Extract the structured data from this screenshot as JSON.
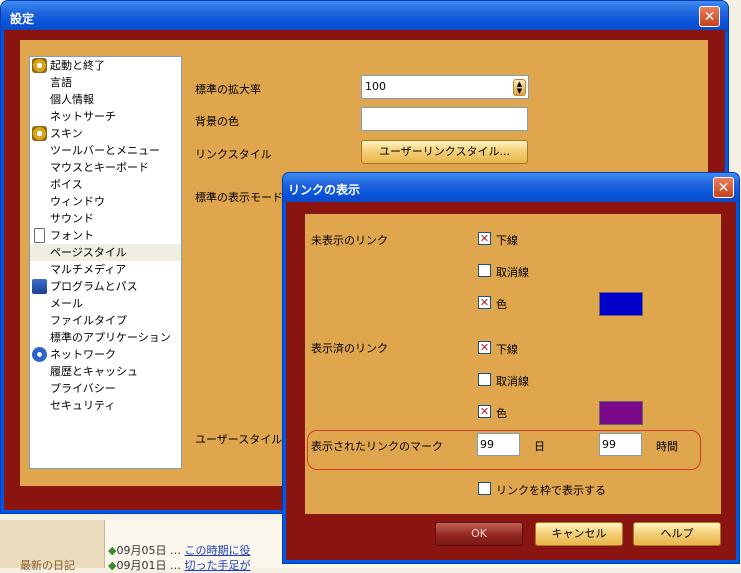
{
  "main_window": {
    "title": "設定",
    "close_glyph": "✕"
  },
  "tree": {
    "items": [
      {
        "label": "起動と終了",
        "level": 0,
        "icon": "gear-icon"
      },
      {
        "label": "言語",
        "level": 1
      },
      {
        "label": "個人情報",
        "level": 1
      },
      {
        "label": "ネットサーチ",
        "level": 1
      },
      {
        "label": "スキン",
        "level": 0,
        "icon": "gear-icon"
      },
      {
        "label": "ツールバーとメニュー",
        "level": 1
      },
      {
        "label": "マウスとキーボード",
        "level": 1
      },
      {
        "label": "ボイス",
        "level": 1
      },
      {
        "label": "ウィンドウ",
        "level": 1
      },
      {
        "label": "サウンド",
        "level": 1
      },
      {
        "label": "フォント",
        "level": 0,
        "icon": "page-icon"
      },
      {
        "label": "ページスタイル",
        "level": 1,
        "selected": true
      },
      {
        "label": "マルチメディア",
        "level": 1
      },
      {
        "label": "プログラムとパス",
        "level": 0,
        "icon": "disk-icon"
      },
      {
        "label": "メール",
        "level": 1
      },
      {
        "label": "ファイルタイプ",
        "level": 1
      },
      {
        "label": "標準のアプリケーション",
        "level": 1
      },
      {
        "label": "ネットワーク",
        "level": 0,
        "icon": "network-icon"
      },
      {
        "label": "履歴とキャッシュ",
        "level": 1
      },
      {
        "label": "プライバシー",
        "level": 1
      },
      {
        "label": "セキュリティ",
        "level": 1
      }
    ]
  },
  "page_style": {
    "zoom_label": "標準の拡大率",
    "zoom_value": "100",
    "bg_color_label": "背景の色",
    "link_style_label": "リンクスタイル",
    "user_link_style_button": "ユーザーリンクスタイル...",
    "display_mode_label": "標準の表示モード",
    "user_stylesheet_label": "ユーザースタイルシ"
  },
  "link_dialog": {
    "title": "リンクの表示",
    "close_glyph": "✕",
    "unvisited_label": "未表示のリンク",
    "visited_label": "表示済のリンク",
    "underline_label": "下線",
    "strikethrough_label": "取消線",
    "color_label": "色",
    "unvisited": {
      "underline": true,
      "strikethrough": false,
      "color": true,
      "swatch": "#0000cc"
    },
    "visited": {
      "underline": true,
      "strikethrough": false,
      "color": true,
      "swatch": "#7a0a8a"
    },
    "mark_label": "表示されたリンクのマーク",
    "days_value": "99",
    "days_unit": "日",
    "hours_value": "99",
    "hours_unit": "時間",
    "frame_links_label": "リンクを枠で表示する",
    "frame_links": false,
    "ok_button": "OK",
    "cancel_button": "キャンセル",
    "help_button": "ヘルプ"
  },
  "background_page": {
    "left_label": "最新の日記",
    "rows": [
      {
        "date": "09月05日",
        "text": "この時期に役"
      },
      {
        "date": "09月01日",
        "text": "切った手足が"
      }
    ]
  },
  "colors": {
    "frame_red": "#8a1410",
    "panel_gold": "#dfa64e",
    "titlebar_blue": "#0a55dc"
  }
}
